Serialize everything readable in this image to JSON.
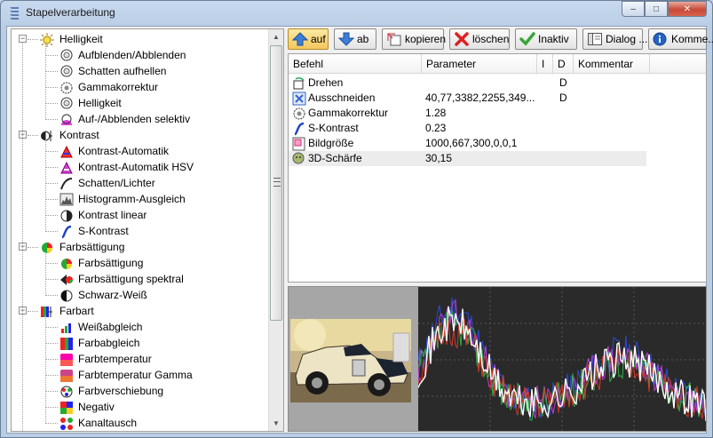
{
  "window": {
    "title": "Stapelverarbeitung"
  },
  "caption": {
    "minimize": "–",
    "maximize": "□",
    "close": "✕"
  },
  "tree": {
    "groups": [
      {
        "label": "Helligkeit",
        "icon": "sun-icon",
        "items": [
          {
            "label": "Aufblenden/Abblenden",
            "icon": "aperture-icon"
          },
          {
            "label": "Schatten aufhellen",
            "icon": "aperture-icon"
          },
          {
            "label": "Gammakorrektur",
            "icon": "gear-icon"
          },
          {
            "label": "Helligkeit",
            "icon": "aperture-icon"
          },
          {
            "label": "Auf-/Abblenden selektiv",
            "icon": "aperture-selective-icon"
          }
        ]
      },
      {
        "label": "Kontrast",
        "icon": "contrast-icon",
        "items": [
          {
            "label": "Kontrast-Automatik",
            "icon": "auto-contrast-icon"
          },
          {
            "label": "Kontrast-Automatik HSV",
            "icon": "auto-contrast-hsv-icon"
          },
          {
            "label": "Schatten/Lichter",
            "icon": "shadow-highlight-icon"
          },
          {
            "label": "Histogramm-Ausgleich",
            "icon": "histogram-icon"
          },
          {
            "label": "Kontrast linear",
            "icon": "linear-contrast-icon"
          },
          {
            "label": "S-Kontrast",
            "icon": "s-curve-icon"
          }
        ]
      },
      {
        "label": "Farbsättigung",
        "icon": "saturation-icon",
        "items": [
          {
            "label": "Farbsättigung",
            "icon": "saturation-icon"
          },
          {
            "label": "Farbsättigung spektral",
            "icon": "spectral-saturation-icon"
          },
          {
            "label": "Schwarz-Weiß",
            "icon": "black-white-icon"
          }
        ]
      },
      {
        "label": "Farbart",
        "icon": "color-bars-icon",
        "items": [
          {
            "label": "Weißabgleich",
            "icon": "white-balance-icon"
          },
          {
            "label": "Farbabgleich",
            "icon": "color-balance-icon"
          },
          {
            "label": "Farbtemperatur",
            "icon": "color-temperature-icon"
          },
          {
            "label": "Farbtemperatur Gamma",
            "icon": "color-temperature-gamma-icon"
          },
          {
            "label": "Farbverschiebung",
            "icon": "color-shift-icon"
          },
          {
            "label": "Negativ",
            "icon": "negative-icon"
          },
          {
            "label": "Kanaltausch",
            "icon": "channel-swap-icon"
          }
        ]
      }
    ]
  },
  "toolbar": {
    "up": "auf",
    "down": "ab",
    "copy": "kopieren",
    "delete": "löschen",
    "inactive": "Inaktiv",
    "dialog": "Dialog ...",
    "comment": "Komme..."
  },
  "list": {
    "columns": [
      "Befehl",
      "Parameter",
      "I",
      "D",
      "Kommentar"
    ],
    "rows": [
      {
        "command": "Drehen",
        "parameter": "",
        "i": "",
        "d": "D",
        "comment": "",
        "icon": "rotate-icon"
      },
      {
        "command": "Ausschneiden",
        "parameter": "40,77,3382,2255,349...",
        "i": "",
        "d": "D",
        "comment": "",
        "icon": "crop-icon"
      },
      {
        "command": "Gammakorrektur",
        "parameter": "1.28",
        "i": "",
        "d": "",
        "comment": "",
        "icon": "gear-icon"
      },
      {
        "command": "S-Kontrast",
        "parameter": "0.23",
        "i": "",
        "d": "",
        "comment": "",
        "icon": "s-curve-icon"
      },
      {
        "command": "Bildgröße",
        "parameter": "1000,667,300,0,0,1",
        "i": "",
        "d": "",
        "comment": "",
        "icon": "resize-icon"
      },
      {
        "command": "3D-Schärfe",
        "parameter": "30,15",
        "i": "",
        "d": "",
        "comment": "",
        "icon": "sharpen-3d-icon",
        "selected": true
      }
    ]
  },
  "preview": {
    "image": "vintage-car-photo",
    "histogram": "rgb-histogram"
  }
}
